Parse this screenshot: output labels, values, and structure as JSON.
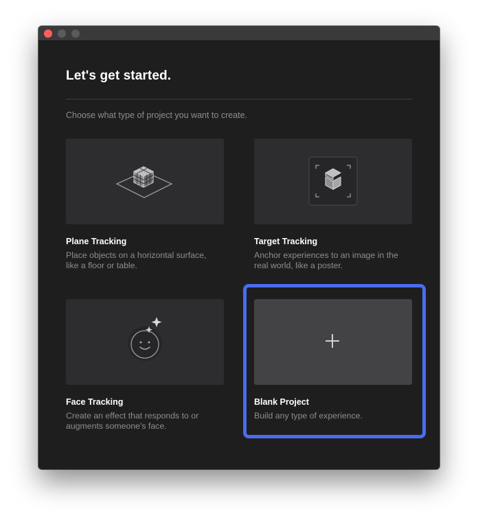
{
  "window": {
    "traffic_lights": [
      "close",
      "minimize",
      "zoom"
    ]
  },
  "header": {
    "title": "Let's get started.",
    "subtitle": "Choose what type of project you want to create."
  },
  "cards": [
    {
      "title": "Plane Tracking",
      "description": "Place objects on a horizontal surface, like a floor or table.",
      "icon": "cube-on-plane-icon"
    },
    {
      "title": "Target Tracking",
      "description": "Anchor experiences to an image in the real world, like a poster.",
      "icon": "target-frame-icon"
    },
    {
      "title": "Face Tracking",
      "description": "Create an effect that responds to or augments someone's face.",
      "icon": "face-sparkle-icon"
    },
    {
      "title": "Blank Project",
      "description": "Build any type of experience.",
      "icon": "plus-icon",
      "selected": true
    }
  ],
  "colors": {
    "window_bg": "#1e1e1f",
    "card_bg": "#2d2d2f",
    "blank_card_bg": "#434345",
    "selection": "#4a6cf0",
    "close_light": "#fe5f57"
  }
}
